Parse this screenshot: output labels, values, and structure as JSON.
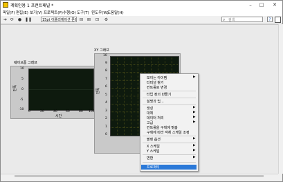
{
  "window": {
    "title": "계획인용 1 프런트패널 *",
    "controls": [
      "–",
      "□",
      "✕"
    ]
  },
  "menu": [
    "파일(F)",
    "편집(E)",
    "보기(V)",
    "프로젝트(P)",
    "수행(O)",
    "도구(T)",
    "윈도우(W)",
    "도움말(H)"
  ],
  "toolbar": {
    "font_select": "15pt 어플리케이션 폰트",
    "search_placeholder": "검색"
  },
  "waveform_graph": {
    "label": "웨이브폼 그래프",
    "ylabel": "진폭",
    "xlabel": "시간",
    "y_ticks": [
      "10",
      "5",
      "0",
      "-5",
      "-10"
    ],
    "x_ticks": [
      "0",
      "20",
      "40",
      "60",
      "80",
      "100"
    ]
  },
  "xy_graph": {
    "label": "XY 그래프",
    "ylabel": "진폭",
    "y_ticks": [
      "10",
      "9",
      "8",
      "7",
      "6",
      "5",
      "4",
      "3",
      "2",
      "1",
      "0"
    ]
  },
  "context_menu": {
    "items": [
      {
        "label": "보이는 아이템",
        "submenu": true
      },
      {
        "label": "터미널 찾기",
        "submenu": false
      },
      {
        "label": "컨트롤로 변경",
        "submenu": false
      },
      {
        "label": "타입 정의 만들기",
        "submenu": false
      },
      {
        "label": "설명과 팁...",
        "submenu": false
      },
      {
        "label": "생성",
        "submenu": true
      },
      {
        "label": "대체",
        "submenu": true
      },
      {
        "label": "데이터 처리",
        "submenu": true
      },
      {
        "label": "고급",
        "submenu": true
      },
      {
        "label": "컨트롤을 구획에 맞춤",
        "submenu": false
      },
      {
        "label": "구획에 따라 객체 스케일 조정",
        "submenu": false
      },
      {
        "label": "팔렛 옵션",
        "submenu": true
      },
      {
        "label": "X 스케일",
        "submenu": true
      },
      {
        "label": "Y 스케일",
        "submenu": true
      },
      {
        "label": "변환",
        "submenu": true
      },
      {
        "label": "프로퍼티",
        "submenu": false
      }
    ]
  },
  "colors": {
    "plot_bg": "#0e1a0e",
    "grid": "#5a5a1a",
    "highlight": "#2b79d8"
  }
}
